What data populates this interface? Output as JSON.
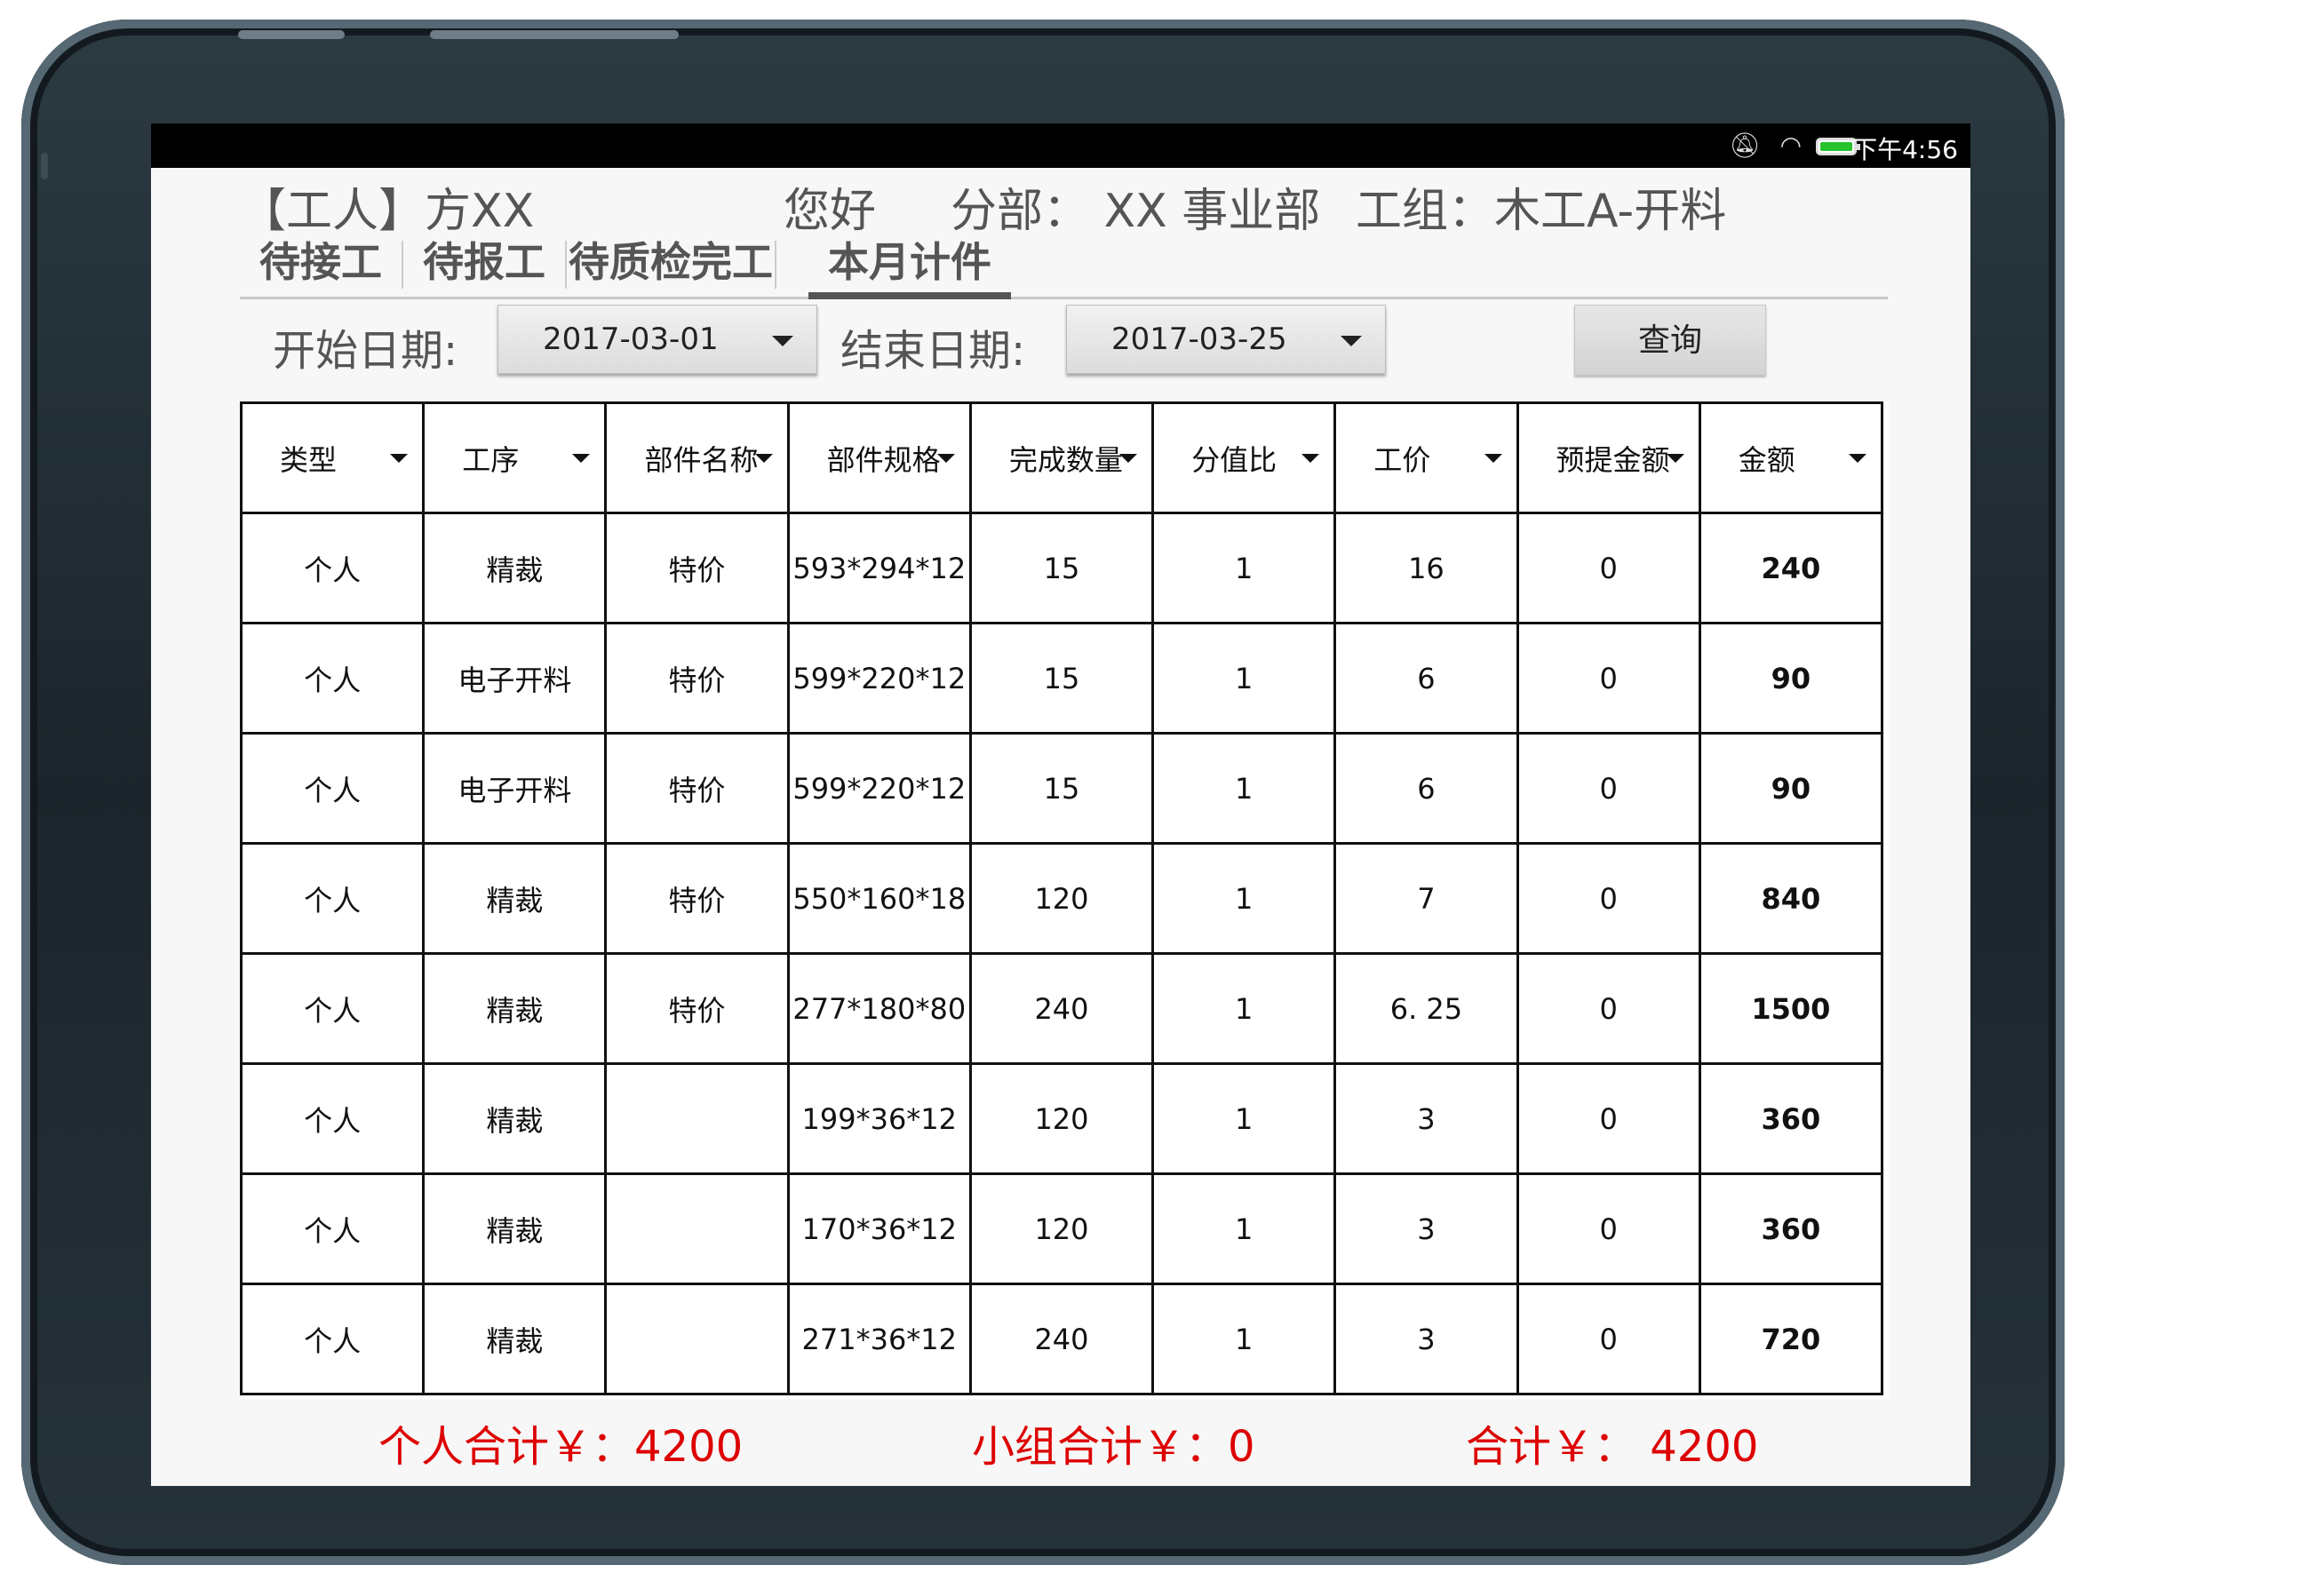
{
  "status": {
    "time": "下午4:56",
    "mute_icon": "bell-off-icon",
    "wifi_icon": "wifi-icon",
    "battery_icon": "battery-icon"
  },
  "header": {
    "worker": "【工人】方XX",
    "greeting": "您好",
    "branch": "分部：  XX 事业部",
    "group": "工组：木工A-开料"
  },
  "tabs": [
    {
      "label": "待接工"
    },
    {
      "label": "待报工"
    },
    {
      "label": "待质检完工"
    },
    {
      "label": "本月计件",
      "active": true
    }
  ],
  "filters": {
    "start_label": "开始日期:",
    "start_value": "2017-03-01",
    "end_label": "结束日期:",
    "end_value": "2017-03-25",
    "query_button": "查询"
  },
  "table": {
    "columns": [
      "类型",
      "工序",
      "部件名称",
      "部件规格",
      "完成数量",
      "分值比",
      "工价",
      "预提金额",
      "金额"
    ],
    "rows": [
      [
        "个人",
        "精裁",
        "特价",
        "593*294*12",
        "15",
        "1",
        "16",
        "0",
        "240"
      ],
      [
        "个人",
        "电子开料",
        "特价",
        "599*220*12",
        "15",
        "1",
        "6",
        "0",
        "90"
      ],
      [
        "个人",
        "电子开料",
        "特价",
        "599*220*12",
        "15",
        "1",
        "6",
        "0",
        "90"
      ],
      [
        "个人",
        "精裁",
        "特价",
        "550*160*18",
        "120",
        "1",
        "7",
        "0",
        "840"
      ],
      [
        "个人",
        "精裁",
        "特价",
        "277*180*80",
        "240",
        "1",
        "6. 25",
        "0",
        "1500"
      ],
      [
        "个人",
        "精裁",
        "",
        "199*36*12",
        "120",
        "1",
        "3",
        "0",
        "360"
      ],
      [
        "个人",
        "精裁",
        "",
        "170*36*12",
        "120",
        "1",
        "3",
        "0",
        "360"
      ],
      [
        "个人",
        "精裁",
        "",
        "271*36*12",
        "240",
        "1",
        "3",
        "0",
        "720"
      ]
    ]
  },
  "totals": {
    "personal": "个人合计￥：4200",
    "group": "小组合计￥：0",
    "total": "合计￥： 4200"
  },
  "colors": {
    "accent_red": "#dd0000",
    "battery_green": "#27c22f"
  }
}
